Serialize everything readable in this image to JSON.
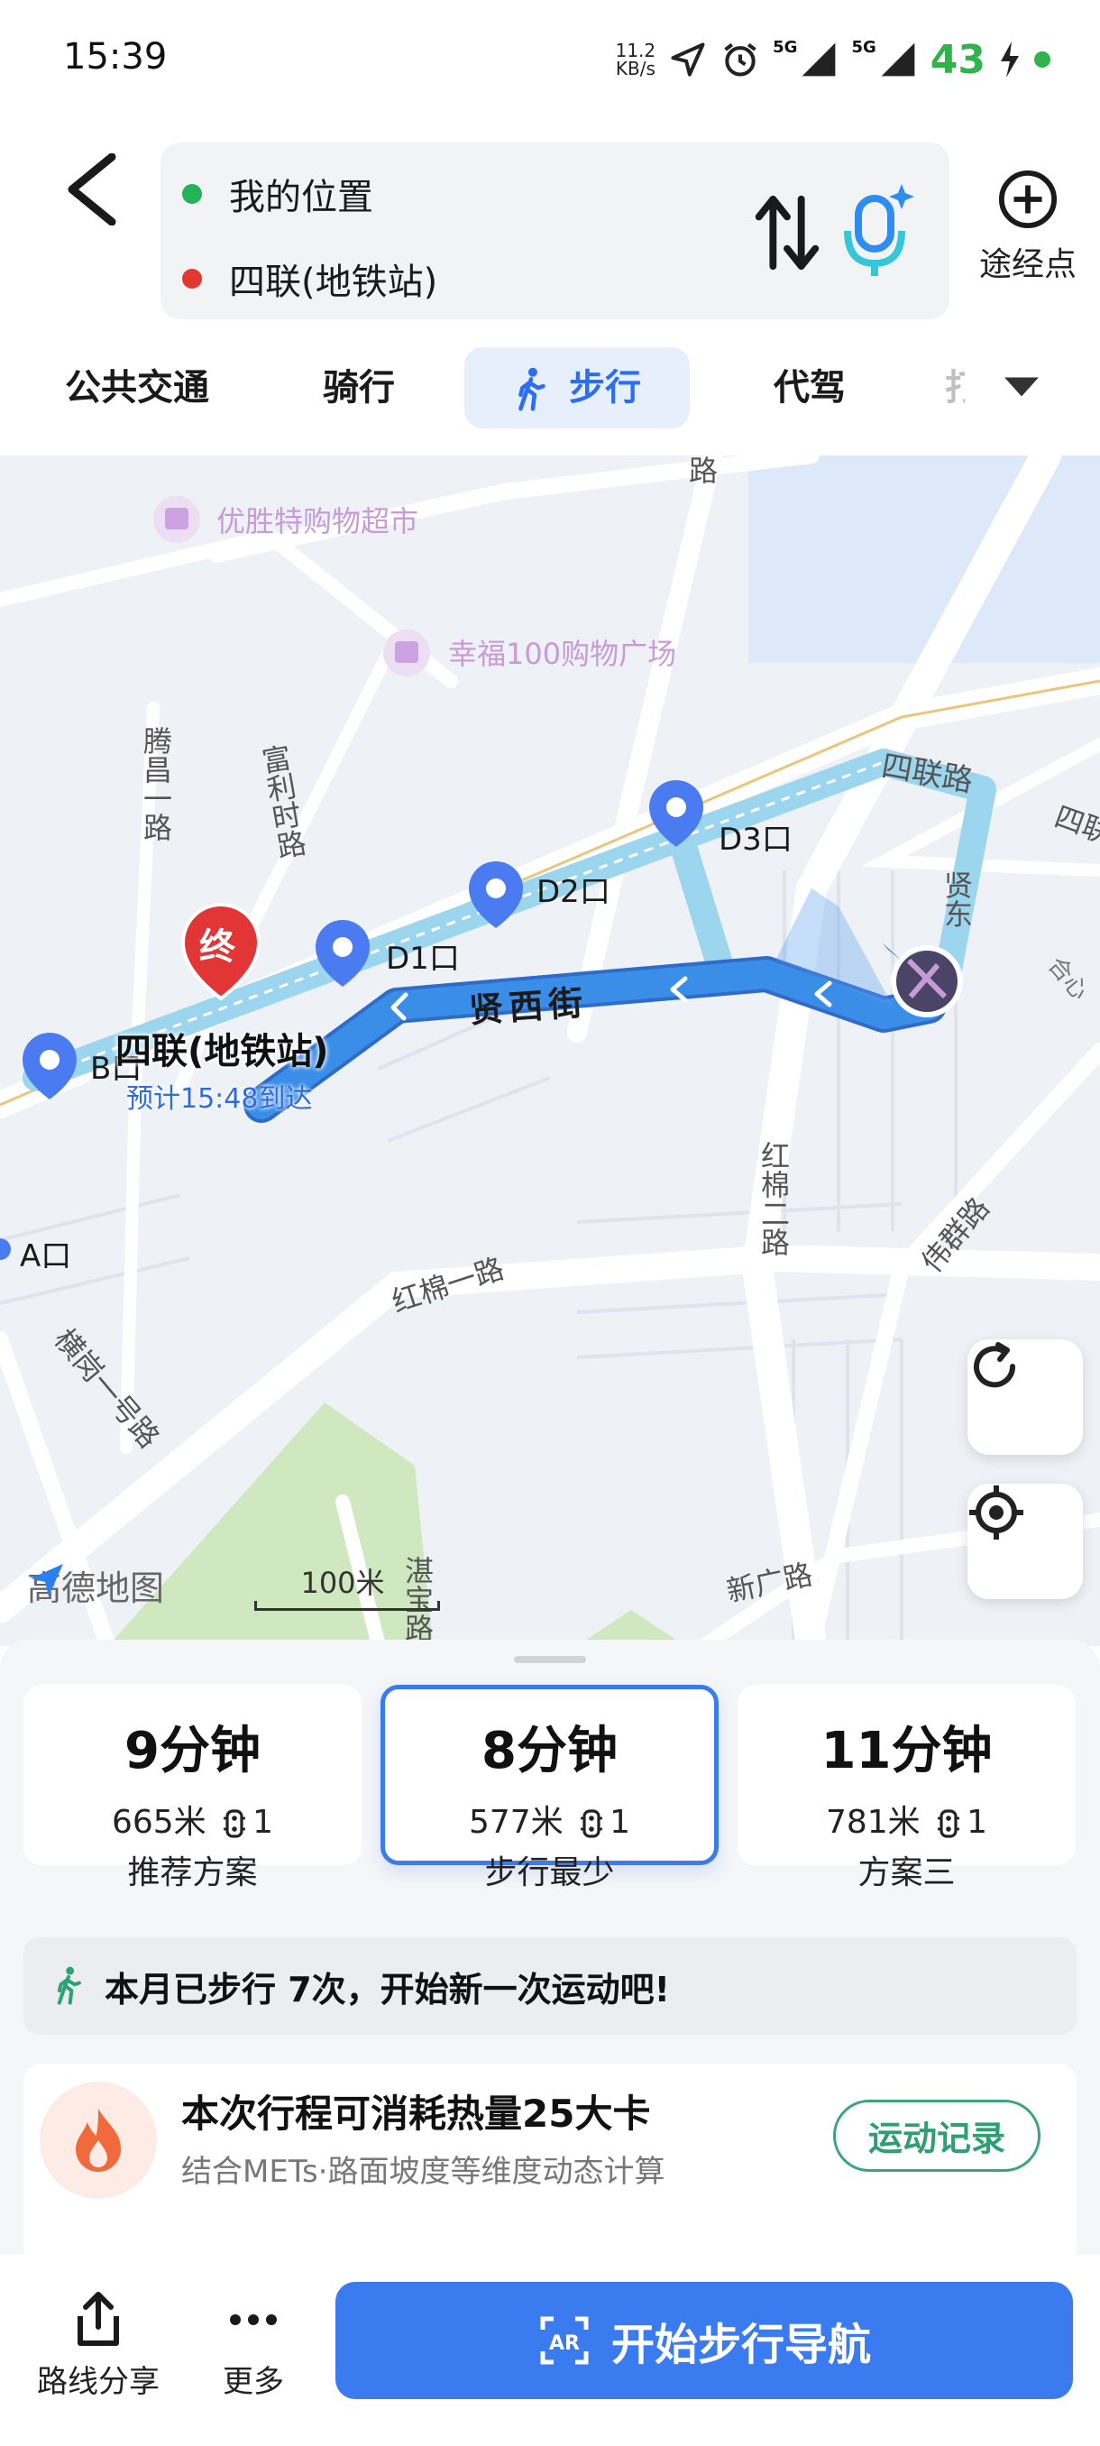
{
  "status_bar": {
    "time": "15:39",
    "net_speed_value": "11.2",
    "net_speed_unit": "KB/s",
    "network_1": "5G",
    "network_2": "5G",
    "battery": "43",
    "icons": [
      "location-arrow-icon",
      "alarm-icon",
      "signal-icon",
      "signal-icon",
      "charging-icon"
    ]
  },
  "header": {
    "origin": "我的位置",
    "destination": "四联(地铁站)",
    "waypoint_label": "途经点",
    "colors": {
      "origin_dot": "#23b35a",
      "destination_dot": "#e3382f"
    }
  },
  "modes": {
    "tabs": [
      "公共交通",
      "骑行",
      "步行",
      "代驾",
      "打车"
    ],
    "active": "步行"
  },
  "map": {
    "pois": [
      "优胜特购物超市",
      "幸福100购物广场"
    ],
    "roads": [
      "四联路",
      "贤西街",
      "红棉一路",
      "红棉二路",
      "腾昌一路",
      "富利时路",
      "横岗一号路",
      "新广路",
      "伟群路",
      "湛宝路",
      "贤东",
      "合心",
      "四联",
      "路"
    ],
    "exits": [
      "D3口",
      "D2口",
      "D1口",
      "B口",
      "A口"
    ],
    "destination_marker": "终",
    "destination_label": "四联(地铁站)",
    "eta": "预计15:48到达",
    "logo": "高德地图",
    "scale": "100米",
    "colors": {
      "route": "#3a8ee8",
      "route_alt": "#9bd6ee",
      "park": "#cfe8bf",
      "water": "#dde9f9",
      "poi": "#cda2e2",
      "marker": "#2f6be0",
      "end": "#e23535"
    }
  },
  "plans": [
    {
      "time": "9分钟",
      "distance": "665米",
      "lights": "1",
      "name": "推荐方案"
    },
    {
      "time": "8分钟",
      "distance": "577米",
      "lights": "1",
      "name": "步行最少"
    },
    {
      "time": "11分钟",
      "distance": "781米",
      "lights": "1",
      "name": "方案三"
    }
  ],
  "selected_plan": "步行最少",
  "walk_banner": "本月已步行 7次，开始新一次运动吧!",
  "calorie": {
    "title": "本次行程可消耗热量25大卡",
    "subtitle": "结合METs·路面坡度等维度动态计算",
    "button": "运动记录"
  },
  "bottom_bar": {
    "share": "路线分享",
    "more": "更多",
    "start": "开始步行导航",
    "ar_icon": "AR"
  }
}
